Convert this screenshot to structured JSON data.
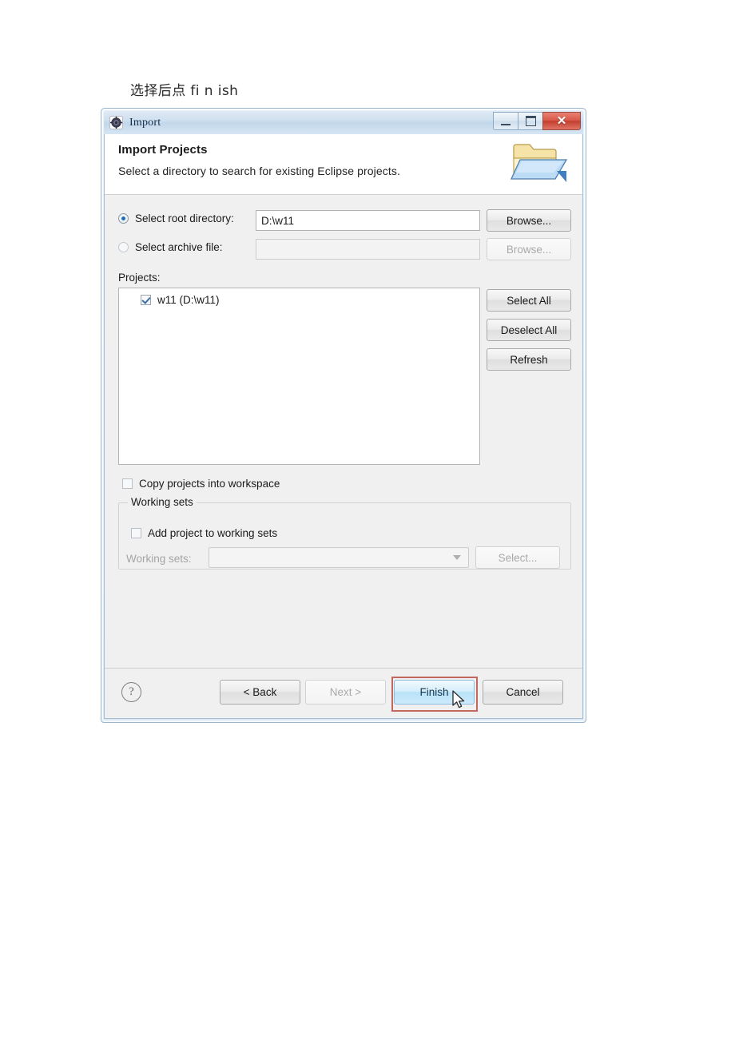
{
  "caption": "选择后点 fi n ish",
  "window": {
    "title": "Import",
    "icon": "eclipse-import-icon",
    "buttons": {
      "minimize": "–",
      "maximize": "□",
      "close": "✕"
    }
  },
  "header": {
    "title": "Import Projects",
    "subtitle": "Select a directory to search for existing Eclipse projects.",
    "icon": "open-folder-icon"
  },
  "source": {
    "root_directory": {
      "label": "Select root directory:",
      "selected": true,
      "value": "D:\\w11",
      "browse_label": "Browse...",
      "browse_enabled": true
    },
    "archive_file": {
      "label": "Select archive file:",
      "selected": false,
      "value": "",
      "browse_label": "Browse...",
      "browse_enabled": false
    }
  },
  "projects": {
    "label": "Projects:",
    "items": [
      {
        "checked": true,
        "name": "w11 (D:\\w11)"
      }
    ],
    "buttons": {
      "select_all": "Select All",
      "deselect_all": "Deselect All",
      "refresh": "Refresh"
    }
  },
  "options": {
    "copy_projects": {
      "label": "Copy projects into workspace",
      "checked": false
    }
  },
  "working_sets": {
    "group_title": "Working sets",
    "add_to_working_sets": {
      "label": "Add project to working sets",
      "checked": false
    },
    "combo_label": "Working sets:",
    "combo_value": "",
    "select_button": "Select..."
  },
  "footer": {
    "help_icon": "?",
    "back": "< Back",
    "next": "Next >",
    "finish": "Finish",
    "cancel": "Cancel",
    "next_enabled": false,
    "finish_highlighted": true
  },
  "annotation": {
    "highlight_color": "#c4685f"
  }
}
